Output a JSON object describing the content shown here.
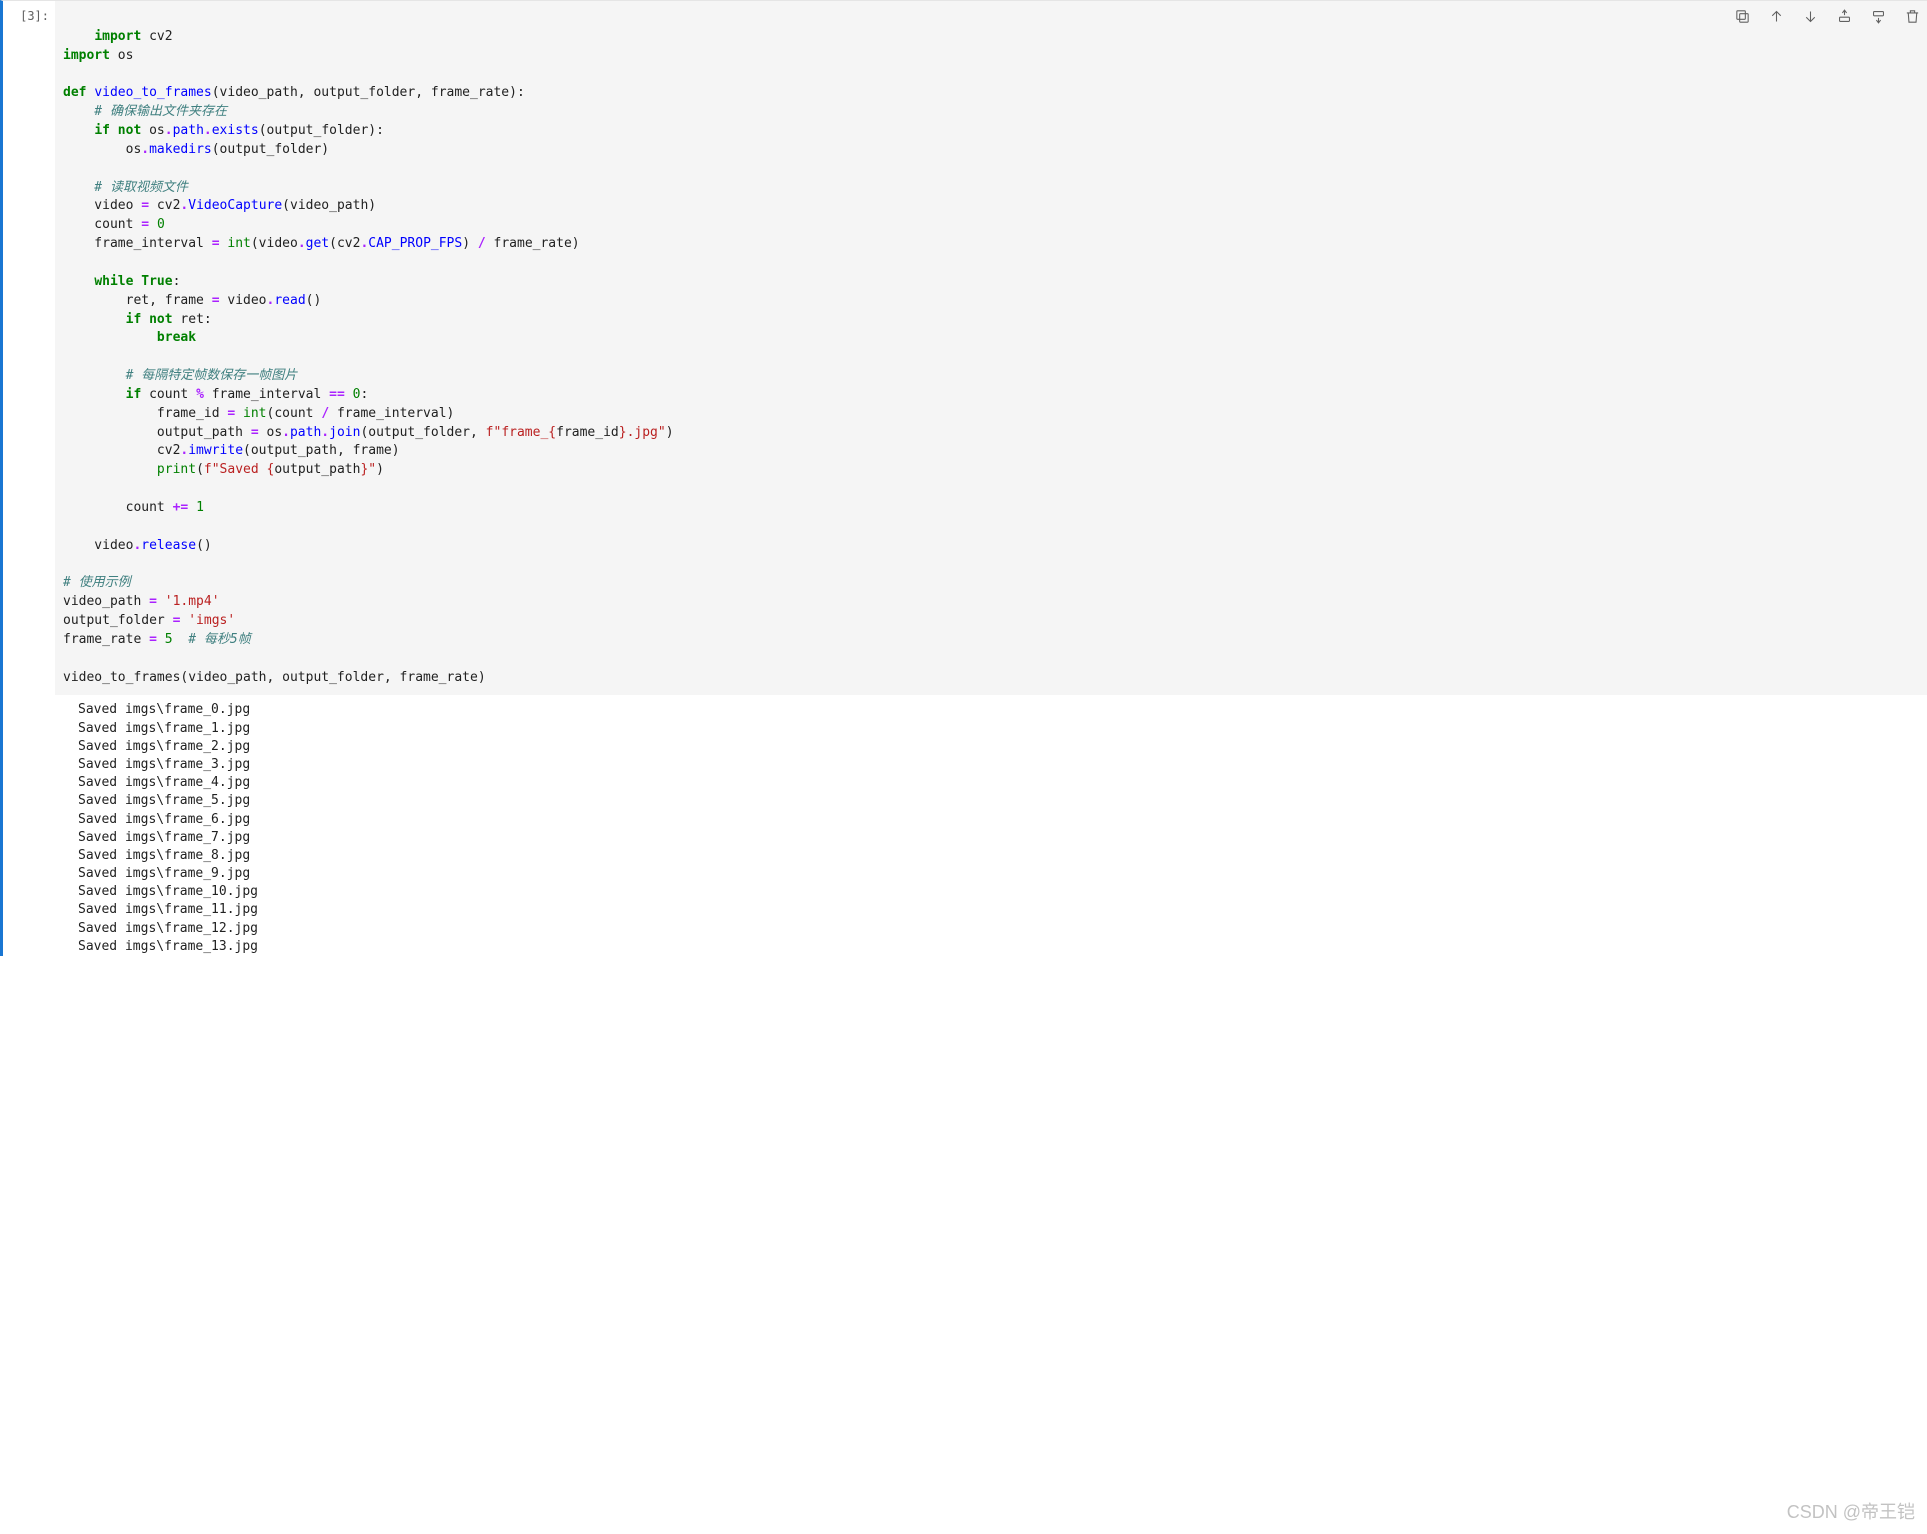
{
  "cell": {
    "exec_count": "3",
    "prompt_label": "[3]:",
    "toolbar": {
      "duplicate": "duplicate-icon",
      "move_up": "arrow-up-icon",
      "move_down": "arrow-down-icon",
      "insert_above": "insert-above-icon",
      "insert_below": "insert-below-icon",
      "delete": "trash-icon"
    },
    "code_tokens": {
      "l1a": "import",
      "l1b": " cv2",
      "l2a": "import",
      "l2b": " os",
      "l4a": "def",
      "l4b": " ",
      "l4c": "video_to_frames",
      "l4d": "(video_path, output_folder, frame_rate):",
      "l5": "    # 确保输出文件夹存在",
      "l6a": "    ",
      "l6b": "if",
      "l6c": " ",
      "l6d": "not",
      "l6e": " os",
      "l6f": ".",
      "l6g": "path",
      "l6h": ".",
      "l6i": "exists",
      "l6j": "(output_folder):",
      "l7a": "        os",
      "l7b": ".",
      "l7c": "makedirs",
      "l7d": "(output_folder)",
      "l9": "    # 读取视频文件",
      "l10a": "    video ",
      "l10b": "=",
      "l10c": " cv2",
      "l10d": ".",
      "l10e": "VideoCapture",
      "l10f": "(video_path)",
      "l11a": "    count ",
      "l11b": "=",
      "l11c": " ",
      "l11d": "0",
      "l12a": "    frame_interval ",
      "l12b": "=",
      "l12c": " ",
      "l12d": "int",
      "l12e": "(video",
      "l12f": ".",
      "l12g": "get",
      "l12h": "(cv2",
      "l12i": ".",
      "l12j": "CAP_PROP_FPS",
      "l12k": ") ",
      "l12l": "/",
      "l12m": " frame_rate)",
      "l14a": "    ",
      "l14b": "while",
      "l14c": " ",
      "l14d": "True",
      "l14e": ":",
      "l15a": "        ret, frame ",
      "l15b": "=",
      "l15c": " video",
      "l15d": ".",
      "l15e": "read",
      "l15f": "()",
      "l16a": "        ",
      "l16b": "if",
      "l16c": " ",
      "l16d": "not",
      "l16e": " ret:",
      "l17a": "            ",
      "l17b": "break",
      "l19": "        # 每隔特定帧数保存一帧图片",
      "l20a": "        ",
      "l20b": "if",
      "l20c": " count ",
      "l20d": "%",
      "l20e": " frame_interval ",
      "l20f": "==",
      "l20g": " ",
      "l20h": "0",
      "l20i": ":",
      "l21a": "            frame_id ",
      "l21b": "=",
      "l21c": " ",
      "l21d": "int",
      "l21e": "(count ",
      "l21f": "/",
      "l21g": " frame_interval)",
      "l22a": "            output_path ",
      "l22b": "=",
      "l22c": " os",
      "l22d": ".",
      "l22e": "path",
      "l22f": ".",
      "l22g": "join",
      "l22h": "(output_folder, ",
      "l22i": "f\"frame_",
      "l22j": "{",
      "l22k": "frame_id",
      "l22l": "}",
      "l22m": ".jpg\"",
      "l22n": ")",
      "l23a": "            cv2",
      "l23b": ".",
      "l23c": "imwrite",
      "l23d": "(output_path, frame)",
      "l24a": "            ",
      "l24b": "print",
      "l24c": "(",
      "l24d": "f\"Saved ",
      "l24e": "{",
      "l24f": "output_path",
      "l24g": "}",
      "l24h": "\"",
      "l24i": ")",
      "l26a": "        count ",
      "l26b": "+=",
      "l26c": " ",
      "l26d": "1",
      "l28a": "    video",
      "l28b": ".",
      "l28c": "release",
      "l28d": "()",
      "l30": "# 使用示例",
      "l31a": "video_path ",
      "l31b": "=",
      "l31c": " ",
      "l31d": "'1.mp4'",
      "l32a": "output_folder ",
      "l32b": "=",
      "l32c": " ",
      "l32d": "'imgs'",
      "l33a": "frame_rate ",
      "l33b": "=",
      "l33c": " ",
      "l33d": "5",
      "l33e": "  ",
      "l33f": "# 每秒5帧",
      "l35a": "video_to_frames(video_path, output_folder, frame_rate)"
    }
  },
  "output": {
    "lines": [
      "Saved imgs\\frame_0.jpg",
      "Saved imgs\\frame_1.jpg",
      "Saved imgs\\frame_2.jpg",
      "Saved imgs\\frame_3.jpg",
      "Saved imgs\\frame_4.jpg",
      "Saved imgs\\frame_5.jpg",
      "Saved imgs\\frame_6.jpg",
      "Saved imgs\\frame_7.jpg",
      "Saved imgs\\frame_8.jpg",
      "Saved imgs\\frame_9.jpg",
      "Saved imgs\\frame_10.jpg",
      "Saved imgs\\frame_11.jpg",
      "Saved imgs\\frame_12.jpg",
      "Saved imgs\\frame_13.jpg"
    ]
  },
  "watermark": "CSDN @帝王铠"
}
